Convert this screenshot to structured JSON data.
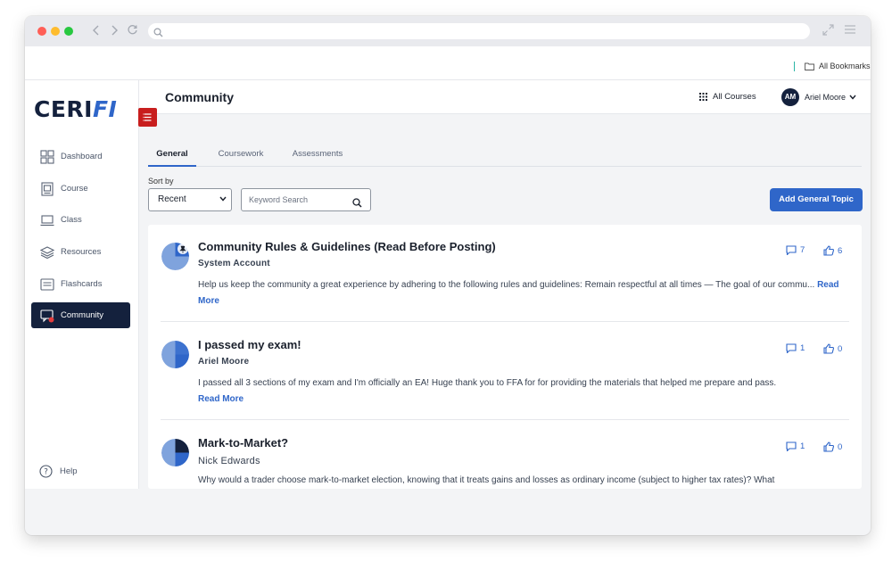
{
  "browser": {
    "bookmarks_label": "All Bookmarks"
  },
  "sidebar": {
    "logo_main": "CERI",
    "logo_accent": "FI",
    "items": [
      {
        "label": "Dashboard",
        "icon": "dashboard-icon"
      },
      {
        "label": "Course",
        "icon": "course-icon"
      },
      {
        "label": "Class",
        "icon": "class-icon"
      },
      {
        "label": "Resources",
        "icon": "resources-icon"
      },
      {
        "label": "Flashcards",
        "icon": "flashcards-icon"
      },
      {
        "label": "Community",
        "icon": "community-icon",
        "active": true
      }
    ],
    "help_label": "Help"
  },
  "header": {
    "title": "Community",
    "all_courses_label": "All Courses",
    "avatar_initials": "AM",
    "user_name": "Ariel Moore"
  },
  "tabs": [
    {
      "label": "General",
      "active": true
    },
    {
      "label": "Coursework"
    },
    {
      "label": "Assessments"
    }
  ],
  "filters": {
    "sort_label": "Sort by",
    "sort_value": "Recent",
    "search_placeholder": "Keyword Search",
    "add_button_label": "Add General Topic"
  },
  "posts": [
    {
      "title": "Community Rules & Guidelines (Read Before Posting)",
      "author": "System Account",
      "body": "Help us keep the community a great experience by adhering to the following rules and guidelines: Remain respectful at all times — The goal of our commu...",
      "read_more": "Read More",
      "comments": "7",
      "likes": "6",
      "pinned": true
    },
    {
      "title": "I passed my exam!",
      "author": "Ariel Moore",
      "body": "I passed all 3 sections of my exam and I'm officially an EA! Huge thank you to FFA for for providing the materials that helped me prepare and pass.",
      "read_more": "Read More",
      "comments": "1",
      "likes": "0"
    },
    {
      "title": "Mark-to-Market?",
      "author": "Nick Edwards",
      "body": "Why would a trader choose mark-to-market election, knowing that it treats gains and losses as ordinary income (subject to higher tax rates)? What",
      "comments": "1",
      "likes": "0"
    }
  ],
  "colors": {
    "brand_navy": "#14213d",
    "accent_blue": "#2f66c9",
    "toggle_red": "#c81e1e"
  }
}
